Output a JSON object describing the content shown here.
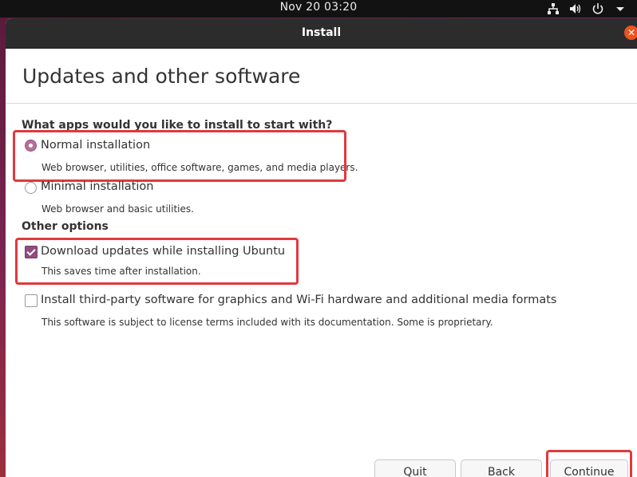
{
  "topbar": {
    "clock": "Nov 20  03:20",
    "icons": [
      "network-icon",
      "volume-icon",
      "power-icon",
      "menu-arrow-icon"
    ]
  },
  "window": {
    "title": "Install",
    "close_symbol": "✕"
  },
  "page": {
    "title": "Updates and other software",
    "apps_question": "What apps would you like to install to start with?",
    "normal_label": "Normal installation",
    "normal_desc": "Web browser, utilities, office software, games, and media players.",
    "minimal_label": "Minimal installation",
    "minimal_desc": "Web browser and basic utilities.",
    "other_heading": "Other options",
    "updates_label": "Download updates while installing Ubuntu",
    "updates_desc": "This saves time after installation.",
    "thirdparty_label": "Install third-party software for graphics and Wi-Fi hardware and additional media formats",
    "thirdparty_desc": "This software is subject to license terms included with its documentation. Some is proprietary."
  },
  "state": {
    "install_type": "normal",
    "download_updates": true,
    "third_party": false
  },
  "buttons": {
    "quit": "Quit",
    "back": "Back",
    "continue": "Continue"
  },
  "colors": {
    "accent": "#8f4d80",
    "highlight": "#e0393e",
    "close": "#e95420"
  }
}
